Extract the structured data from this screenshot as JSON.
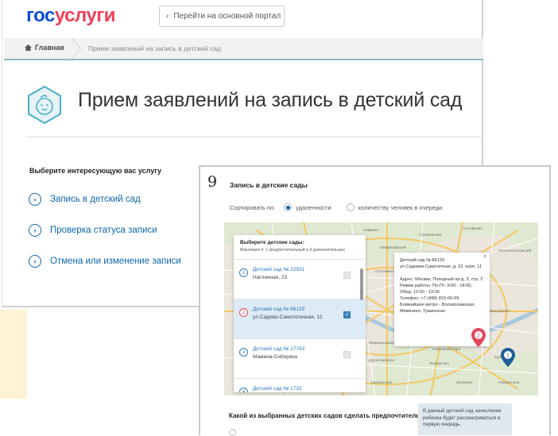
{
  "header": {
    "logo_part1": "гос",
    "logo_part2": "услуги",
    "portal_button": "Перейти на основной портал"
  },
  "breadcrumb": {
    "home": "Главная",
    "current": "Прием заявлений на запись в детский сад"
  },
  "page": {
    "title": "Прием заявлений на запись в детский сад",
    "choose_label": "Выберите интересующую вас услугу",
    "services": [
      "Запись в детский сад",
      "Проверка статуса записи",
      "Отмена или изменение записи"
    ]
  },
  "step": {
    "number": "9",
    "title": "Запись в детские сады",
    "sort_label": "Сортировать по:",
    "sort_options": [
      "удаленности",
      "количеству человек в очереди"
    ],
    "sort_selected": "удаленности"
  },
  "kindergarten_list": {
    "heading": "Выберите детские сады:",
    "subheading": "Максимум 4: 1 предпочтительный и 3 дополнительных",
    "items": [
      {
        "num": "1",
        "name": "Детский сад № 22931",
        "address": "Наглинная, 23",
        "checked": false
      },
      {
        "num": "2",
        "name": "Детский сад № 86129",
        "address": "ул.Садово-Самототечная, 12",
        "checked": true
      },
      {
        "num": "3",
        "name": "Детский сад № 17783",
        "address": "Мамина-Сибиряка",
        "checked": false
      },
      {
        "num": "4",
        "name": "Детский сад № 1732",
        "address": "",
        "checked": false
      }
    ]
  },
  "info_popup": {
    "name": "Детский сад № 86129",
    "address_line": "ул.Садовая-Самотечная, д. 22, корп. 11",
    "full_address": "Адрес: Москва, Походный пр-д, 3, стр. 2",
    "hours": "Режим работы: Пн-Пт: 9:00 - 18:00, Обед: 12:00 - 13:00",
    "phone": "Телефон: +7 (495) 815-00-09",
    "metro": "Ближайшее метро - Волоколамская, Мякинино, Тушинская"
  },
  "map": {
    "labels": [
      "Ховрино",
      "Головинский",
      "Тимирязевский",
      "Останкинский",
      "Алтуфьево",
      "Лосиноостровский",
      "Марьина роща",
      "Новогиреево",
      "Перово",
      "Лефортово",
      "Кузьминки",
      "Люблино",
      "Соколиная гора",
      "Крылатское",
      "Дорогомилово",
      "Новокосино"
    ],
    "pin_red": "2",
    "pin_blue": "1"
  },
  "bottom": {
    "question": "Какой из выбранных детских садов сделать предпочтительным?",
    "help": "?",
    "hint": "В данный детский сад зачисление ребенка будет рассматриваться в первую очередь."
  },
  "colors": {
    "brand_blue": "#0d4cd3",
    "brand_red": "#ee3f58",
    "link": "#0e66a7"
  }
}
